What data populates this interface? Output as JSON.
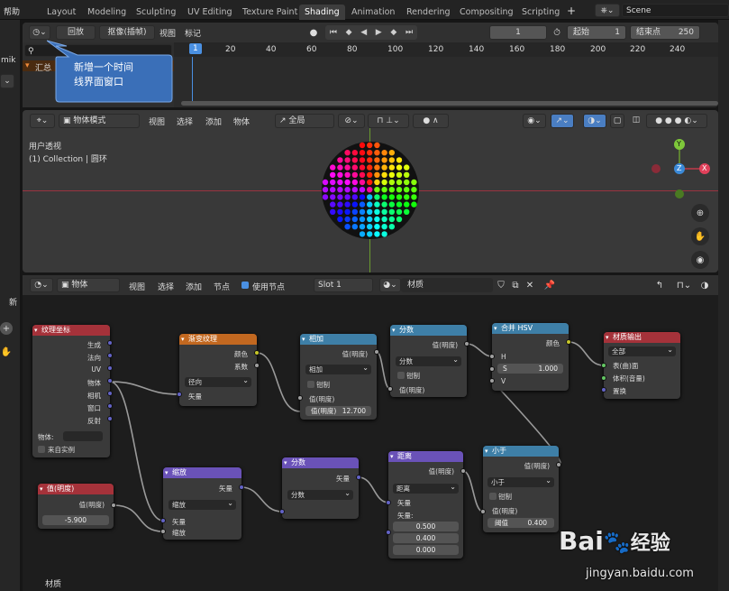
{
  "menu": {
    "help": "帮助"
  },
  "workspace_tabs": [
    "Layout",
    "Modeling",
    "Sculpting",
    "UV Editing",
    "Texture Paint",
    "Shading",
    "Animation",
    "Rendering",
    "Compositing",
    "Scripting"
  ],
  "active_tab": "Shading",
  "add_tab": "+",
  "scene": {
    "label": "Scene"
  },
  "left_strip": {
    "a": "mik",
    "b": "新"
  },
  "timeline": {
    "playback": "回放",
    "keying": "抠像(插帧)",
    "view": "视图",
    "marker": "标记",
    "current_frame": "1",
    "start_label": "起始",
    "start_value": "1",
    "end_label": "结束点",
    "end_value": "250",
    "ruler": [
      "1",
      "20",
      "40",
      "60",
      "80",
      "100",
      "120",
      "140",
      "160",
      "180",
      "200",
      "220",
      "240"
    ],
    "summary": "汇总"
  },
  "callout": {
    "line1": "新增一个时间",
    "line2": "线界面窗口"
  },
  "viewport": {
    "mode": "物体模式",
    "view": "视图",
    "select": "选择",
    "add": "添加",
    "object": "物体",
    "orientation": "全局",
    "info_line1": "用户透视",
    "info_line2": "(1) Collection | 圆环",
    "axis_y": "Y",
    "axis_z": "Z",
    "axis_x": "X"
  },
  "node_editor": {
    "object": "物体",
    "view": "视图",
    "select": "选择",
    "add": "添加",
    "node": "节点",
    "use_nodes": "使用节点",
    "slot": "Slot 1",
    "material": "材质",
    "footer": "材质"
  },
  "nodes": {
    "texcoord": {
      "title": "纹理坐标",
      "outputs": [
        "生成",
        "法向",
        "UV",
        "物体",
        "相机",
        "窗口",
        "反射"
      ],
      "object_label": "物体:",
      "from_instancer": "来自实例"
    },
    "gradient": {
      "title": "渐变纹理",
      "outputs": [
        "颜色",
        "系数"
      ],
      "type": "径向",
      "input": "矢量"
    },
    "add": {
      "title": "相加",
      "output": "值(明度)",
      "op": "相加",
      "clamp": "钳制",
      "input1": "值(明度)",
      "input2_label": "值(明度)",
      "input2_value": "12.700"
    },
    "divide1": {
      "title": "分数",
      "output": "值(明度)",
      "op": "分数",
      "clamp": "钳制",
      "input": "值(明度)"
    },
    "combinehsv": {
      "title": "合并 HSV",
      "output": "颜色",
      "h": "H",
      "s": "S",
      "s_value": "1.000",
      "v": "V"
    },
    "output": {
      "title": "材质输出",
      "target": "全部",
      "surface": "表(曲)面",
      "volume": "体积(音量)",
      "displacement": "置换"
    },
    "value": {
      "title": "值(明度)",
      "output": "值(明度)",
      "value": "-5.900"
    },
    "scale": {
      "title": "缩放",
      "output": "矢量",
      "op": "缩放",
      "input1": "矢量",
      "input2": "缩放"
    },
    "divide2": {
      "title": "分数",
      "output": "矢量",
      "op": "分数"
    },
    "distance": {
      "title": "距离",
      "output": "值(明度)",
      "op": "距离",
      "input1": "矢量",
      "input2": "矢量:",
      "vals": [
        "0.500",
        "0.400",
        "0.000"
      ]
    },
    "less": {
      "title": "小于",
      "output": "值(明度)",
      "op": "小于",
      "clamp": "钳制",
      "input": "值(明度)",
      "thr_label": "阈值",
      "thr_value": "0.400"
    }
  },
  "watermark": {
    "brand": "Bai",
    "brand2": "经验",
    "url": "jingyan.baidu.com"
  },
  "colors": {
    "input_node": "#a5323a",
    "texture_node": "#c26820",
    "converter_node": "#3e7fa7",
    "shader_output": "#a5323a",
    "vector_node": "#6a52b8",
    "socket_yellow": "#c7c729",
    "socket_gray": "#a0a0a0",
    "socket_purple": "#6363c7",
    "socket_green": "#63c763",
    "frame_blue": "#4a90e2"
  }
}
